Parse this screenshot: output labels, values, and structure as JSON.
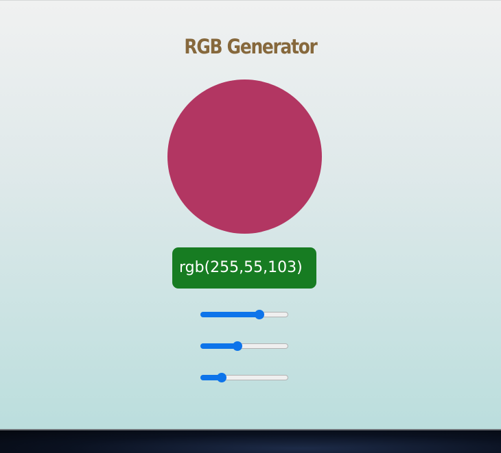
{
  "app": {
    "title": "RGB Generator"
  },
  "color": {
    "r": 255,
    "g": 55,
    "b": 103,
    "swatch_hex": "#b23662",
    "readout_bg": "#177c22",
    "accent": "#0d74ea"
  },
  "readout": {
    "text": "rgb(255,55,103)"
  },
  "sliders": [
    {
      "value": 0.67
    },
    {
      "value": 0.42
    },
    {
      "value": 0.24
    }
  ]
}
